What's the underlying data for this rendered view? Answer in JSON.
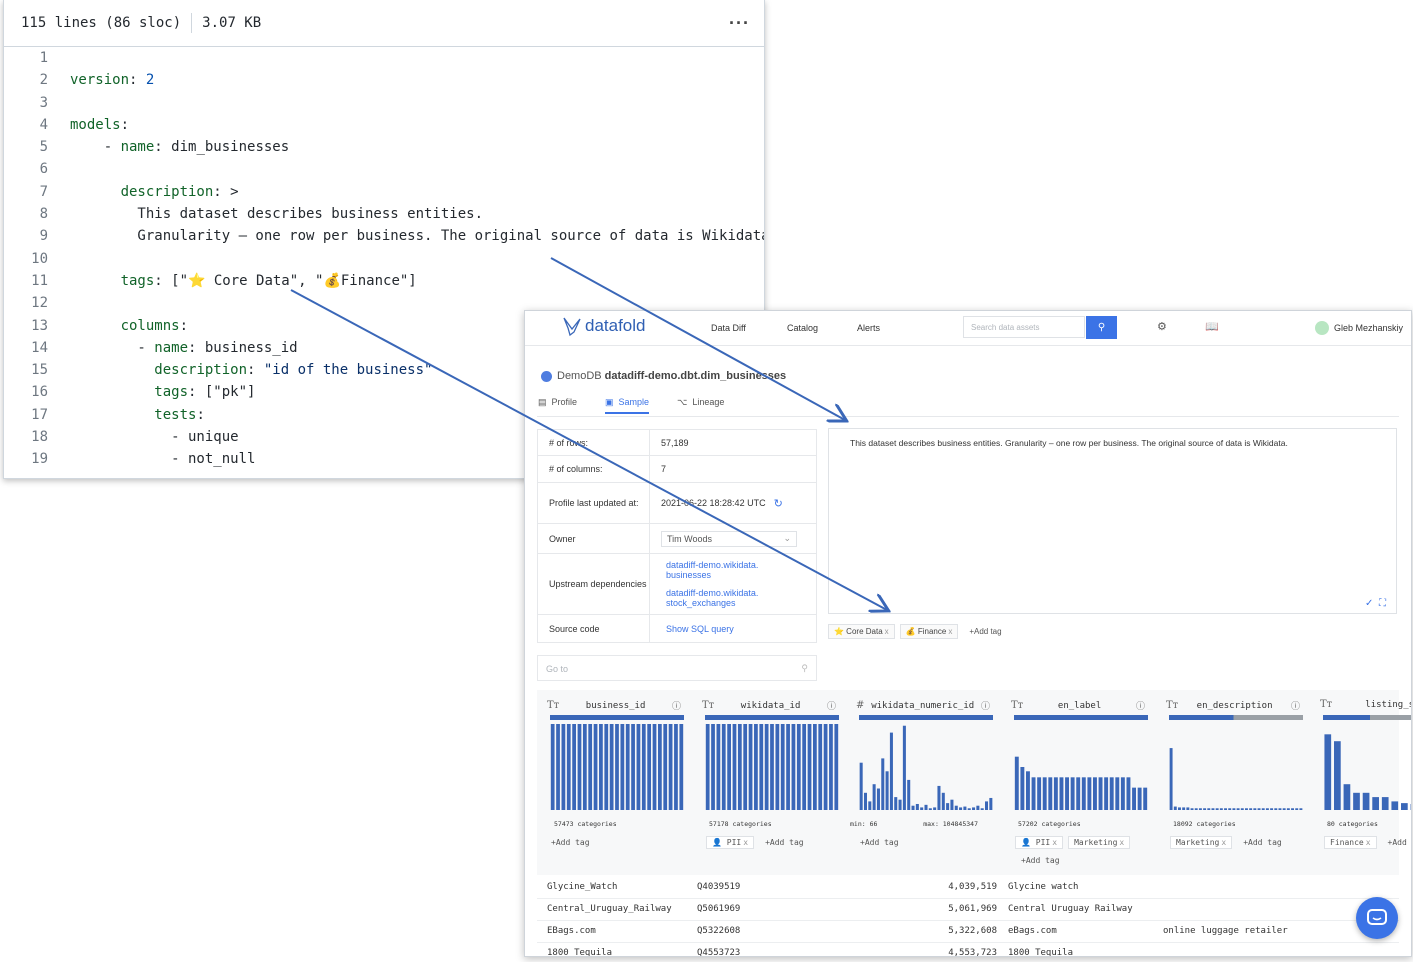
{
  "code": {
    "meta_lines": "115 lines (86 sloc)",
    "meta_size": "3.07 KB",
    "more": "···",
    "lines": [
      {
        "n": "1",
        "parts": []
      },
      {
        "n": "2",
        "parts": [
          {
            "t": "version",
            "c": "k"
          },
          {
            "t": ": ",
            "c": ""
          },
          {
            "t": "2",
            "c": "n"
          }
        ]
      },
      {
        "n": "3",
        "parts": []
      },
      {
        "n": "4",
        "parts": [
          {
            "t": "models",
            "c": "k"
          },
          {
            "t": ":",
            "c": ""
          }
        ]
      },
      {
        "n": "5",
        "parts": [
          {
            "t": "    - ",
            "c": ""
          },
          {
            "t": "name",
            "c": "k"
          },
          {
            "t": ": dim_businesses",
            "c": ""
          }
        ]
      },
      {
        "n": "6",
        "parts": []
      },
      {
        "n": "7",
        "parts": [
          {
            "t": "      ",
            "c": ""
          },
          {
            "t": "description",
            "c": "k"
          },
          {
            "t": ": >",
            "c": ""
          }
        ]
      },
      {
        "n": "8",
        "parts": [
          {
            "t": "        This dataset describes business entities.",
            "c": ""
          }
        ]
      },
      {
        "n": "9",
        "parts": [
          {
            "t": "        Granularity – one row per business. The original source of data is Wikidata.",
            "c": ""
          }
        ]
      },
      {
        "n": "10",
        "parts": []
      },
      {
        "n": "11",
        "parts": [
          {
            "t": "      ",
            "c": ""
          },
          {
            "t": "tags",
            "c": "k"
          },
          {
            "t": ": [\"⭐ Core Data\", \"💰Finance\"]",
            "c": ""
          }
        ]
      },
      {
        "n": "12",
        "parts": []
      },
      {
        "n": "13",
        "parts": [
          {
            "t": "      ",
            "c": ""
          },
          {
            "t": "columns",
            "c": "k"
          },
          {
            "t": ":",
            "c": ""
          }
        ]
      },
      {
        "n": "14",
        "parts": [
          {
            "t": "        - ",
            "c": ""
          },
          {
            "t": "name",
            "c": "k"
          },
          {
            "t": ": business_id",
            "c": ""
          }
        ]
      },
      {
        "n": "15",
        "parts": [
          {
            "t": "          ",
            "c": ""
          },
          {
            "t": "description",
            "c": "k"
          },
          {
            "t": ": ",
            "c": ""
          },
          {
            "t": "\"id of the business\"",
            "c": "s"
          }
        ]
      },
      {
        "n": "16",
        "parts": [
          {
            "t": "          ",
            "c": ""
          },
          {
            "t": "tags",
            "c": "k"
          },
          {
            "t": ": [\"pk\"]",
            "c": ""
          }
        ]
      },
      {
        "n": "17",
        "parts": [
          {
            "t": "          ",
            "c": ""
          },
          {
            "t": "tests",
            "c": "k"
          },
          {
            "t": ":",
            "c": ""
          }
        ]
      },
      {
        "n": "18",
        "parts": [
          {
            "t": "            - unique",
            "c": ""
          }
        ]
      },
      {
        "n": "19",
        "parts": [
          {
            "t": "            - not_null",
            "c": ""
          }
        ]
      }
    ]
  },
  "app": {
    "logo": "datafold",
    "nav": [
      "Data Diff",
      "Catalog",
      "Alerts"
    ],
    "search_placeholder": "Search data assets",
    "user": "Gleb Mezhanskiy",
    "crumb_db": "DemoDB",
    "crumb_path": "datadiff-demo.dbt.dim_businesses",
    "tabs": [
      "Profile",
      "Sample",
      "Lineage"
    ],
    "props": {
      "rows_label": "# of rows:",
      "rows_value": "57,189",
      "cols_label": "# of columns:",
      "cols_value": "7",
      "updated_label": "Profile last updated at:",
      "updated_value": "2021-06-22 18:28:42 UTC",
      "owner_label": "Owner",
      "owner_value": "Tim Woods",
      "upstream_label": "Upstream dependencies",
      "upstream_1": "datadiff-demo.wikidata. businesses",
      "upstream_2": "datadiff-demo.wikidata. stock_exchanges",
      "source_label": "Source code",
      "source_value": "Show SQL query"
    },
    "description": "This dataset describes business entities. Granularity – one row per business. The original source of data is Wikidata.",
    "tags": [
      "⭐ Core Data",
      "💰 Finance"
    ],
    "add_tag": "+Add tag",
    "goto_placeholder": "Go to",
    "profile_columns": [
      {
        "name": "business_id",
        "type": "Tт",
        "stat": "57473 categories",
        "tags": [],
        "hist": [
          1,
          1,
          1,
          1,
          1,
          1,
          1,
          1,
          1,
          1,
          1,
          1,
          1,
          1,
          1,
          1,
          1,
          1,
          1,
          1,
          1,
          1,
          1,
          1,
          1
        ],
        "bar_fill": 1.0
      },
      {
        "name": "wikidata_id",
        "type": "Tт",
        "stat": "57178 categories",
        "tags": [
          "👤 PII"
        ],
        "hist": [
          1,
          1,
          1,
          1,
          1,
          1,
          1,
          1,
          1,
          1,
          1,
          1,
          1,
          1,
          1,
          1,
          1,
          1,
          1,
          1,
          1,
          1,
          1,
          1,
          1
        ],
        "bar_fill": 1.0
      },
      {
        "name": "wikidata_numeric_id",
        "type": "#",
        "stat_min": "min: 66",
        "stat_max": "max: 104845347",
        "tags": [],
        "hist": [
          0.55,
          0.2,
          0.1,
          0.3,
          0.25,
          0.6,
          0.45,
          0.9,
          0.15,
          0.12,
          0.98,
          0.35,
          0.05,
          0.07,
          0.03,
          0.06,
          0.02,
          0.03,
          0.28,
          0.2,
          0.08,
          0.12,
          0.05,
          0.03,
          0.04,
          0.02,
          0.03,
          0.05,
          0.02,
          0.1,
          0.14
        ],
        "bar_fill": 1.0
      },
      {
        "name": "en_label",
        "type": "Tт",
        "stat": "57202 categories",
        "tags": [
          "👤 PII",
          "Marketing"
        ],
        "hist": [
          0.62,
          0.5,
          0.45,
          0.38,
          0.38,
          0.38,
          0.38,
          0.38,
          0.38,
          0.38,
          0.38,
          0.38,
          0.38,
          0.38,
          0.38,
          0.38,
          0.38,
          0.38,
          0.38,
          0.38,
          0.38,
          0.26,
          0.26,
          0.26
        ],
        "bar_fill": 1.0
      },
      {
        "name": "en_description",
        "type": "Tт",
        "stat": "18092 categories",
        "tags": [
          "Marketing"
        ],
        "hist": [
          0.72,
          0.04,
          0.03,
          0.03,
          0.03,
          0.02,
          0.02,
          0.02,
          0.02,
          0.02,
          0.02,
          0.02,
          0.02,
          0.02,
          0.02,
          0.02,
          0.02,
          0.02,
          0.02,
          0.02,
          0.02,
          0.02,
          0.02,
          0.02,
          0.02,
          0.02,
          0.02,
          0.02,
          0.02,
          0.02,
          0.02,
          0.02
        ],
        "bar_fill": 0.48
      },
      {
        "name": "listing_sto",
        "type": "Tт",
        "stat": "80 categories",
        "tags": [
          "Finance"
        ],
        "hist": [
          0.88,
          0.8,
          0.3,
          0.2,
          0.2,
          0.15,
          0.15,
          0.1,
          0.08,
          0.07,
          0.07,
          0.06,
          0.06,
          0.06
        ],
        "bar_fill": 0.35
      }
    ],
    "sample_rows": [
      {
        "c1": "Glycine_Watch",
        "c2": "Q4039519",
        "c3": "4,039,519",
        "c4": "Glycine watch",
        "c5": ""
      },
      {
        "c1": "Central_Uruguay_Railway",
        "c2": "Q5061969",
        "c3": "5,061,969",
        "c4": "Central Uruguay Railway",
        "c5": ""
      },
      {
        "c1": "EBags.com",
        "c2": "Q5322608",
        "c3": "5,322,608",
        "c4": "eBags.com",
        "c5": "online luggage retailer"
      },
      {
        "c1": "1800_Tequila",
        "c2": "Q4553723",
        "c3": "4,553,723",
        "c4": "1800 Tequila",
        "c5": ""
      }
    ]
  },
  "colors": {
    "accent": "#3b73e6",
    "bars": "#3a67b8",
    "arrow": "#3a67b8"
  }
}
